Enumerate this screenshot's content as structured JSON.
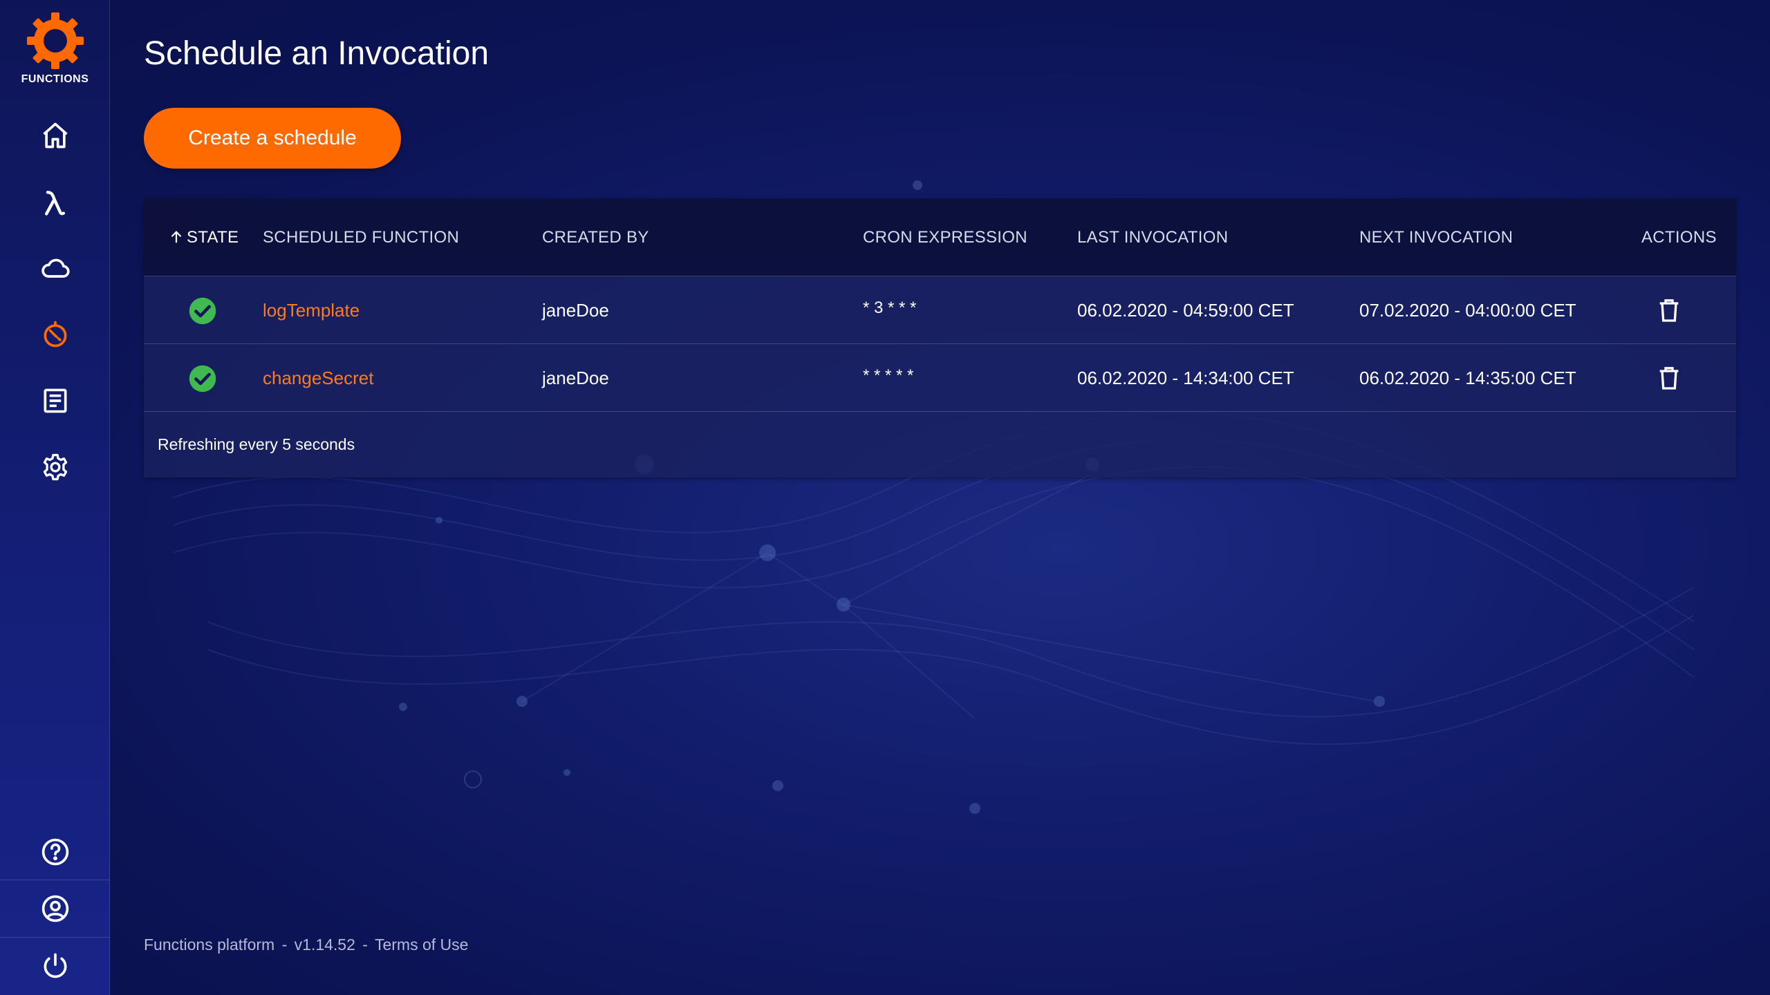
{
  "app": {
    "logo_text": "FUNCTIONS",
    "accent_color": "#ff6a00",
    "success_color": "#3fb950"
  },
  "sidebar": {
    "items": [
      {
        "name": "home",
        "icon": "home-icon",
        "active": false
      },
      {
        "name": "functions",
        "icon": "lambda-icon",
        "active": false
      },
      {
        "name": "cloud",
        "icon": "cloud-icon",
        "active": false
      },
      {
        "name": "schedule",
        "icon": "timer-icon",
        "active": true
      },
      {
        "name": "logs",
        "icon": "document-icon",
        "active": false
      },
      {
        "name": "settings",
        "icon": "gear-icon",
        "active": false
      }
    ],
    "bottom_items": [
      {
        "name": "help",
        "icon": "help-icon"
      },
      {
        "name": "account",
        "icon": "account-icon"
      },
      {
        "name": "logout",
        "icon": "power-icon"
      }
    ]
  },
  "page": {
    "title": "Schedule an Invocation",
    "create_button": "Create a schedule"
  },
  "table": {
    "columns": {
      "state": "STATE",
      "scheduled_function": "SCHEDULED FUNCTION",
      "created_by": "CREATED BY",
      "cron_expression": "CRON EXPRESSION",
      "last_invocation": "LAST INVOCATION",
      "next_invocation": "NEXT INVOCATION",
      "actions": "ACTIONS"
    },
    "sort": {
      "column": "state",
      "direction": "ascending"
    },
    "rows": [
      {
        "state": "success",
        "function": "logTemplate",
        "created_by": "janeDoe",
        "cron": "* 3 * * *",
        "last_invocation": "06.02.2020 - 04:59:00 CET",
        "next_invocation": "07.02.2020 - 04:00:00 CET",
        "action_icon": "trash-icon"
      },
      {
        "state": "success",
        "function": "changeSecret",
        "created_by": "janeDoe",
        "cron": "* * * * *",
        "last_invocation": "06.02.2020 - 14:34:00 CET",
        "next_invocation": "06.02.2020 - 14:35:00 CET",
        "action_icon": "trash-icon"
      }
    ],
    "footer_text": "Refreshing every 5 seconds"
  },
  "footer": {
    "platform": "Functions platform",
    "separator": "-",
    "version": "v1.14.52",
    "terms": "Terms of Use"
  }
}
